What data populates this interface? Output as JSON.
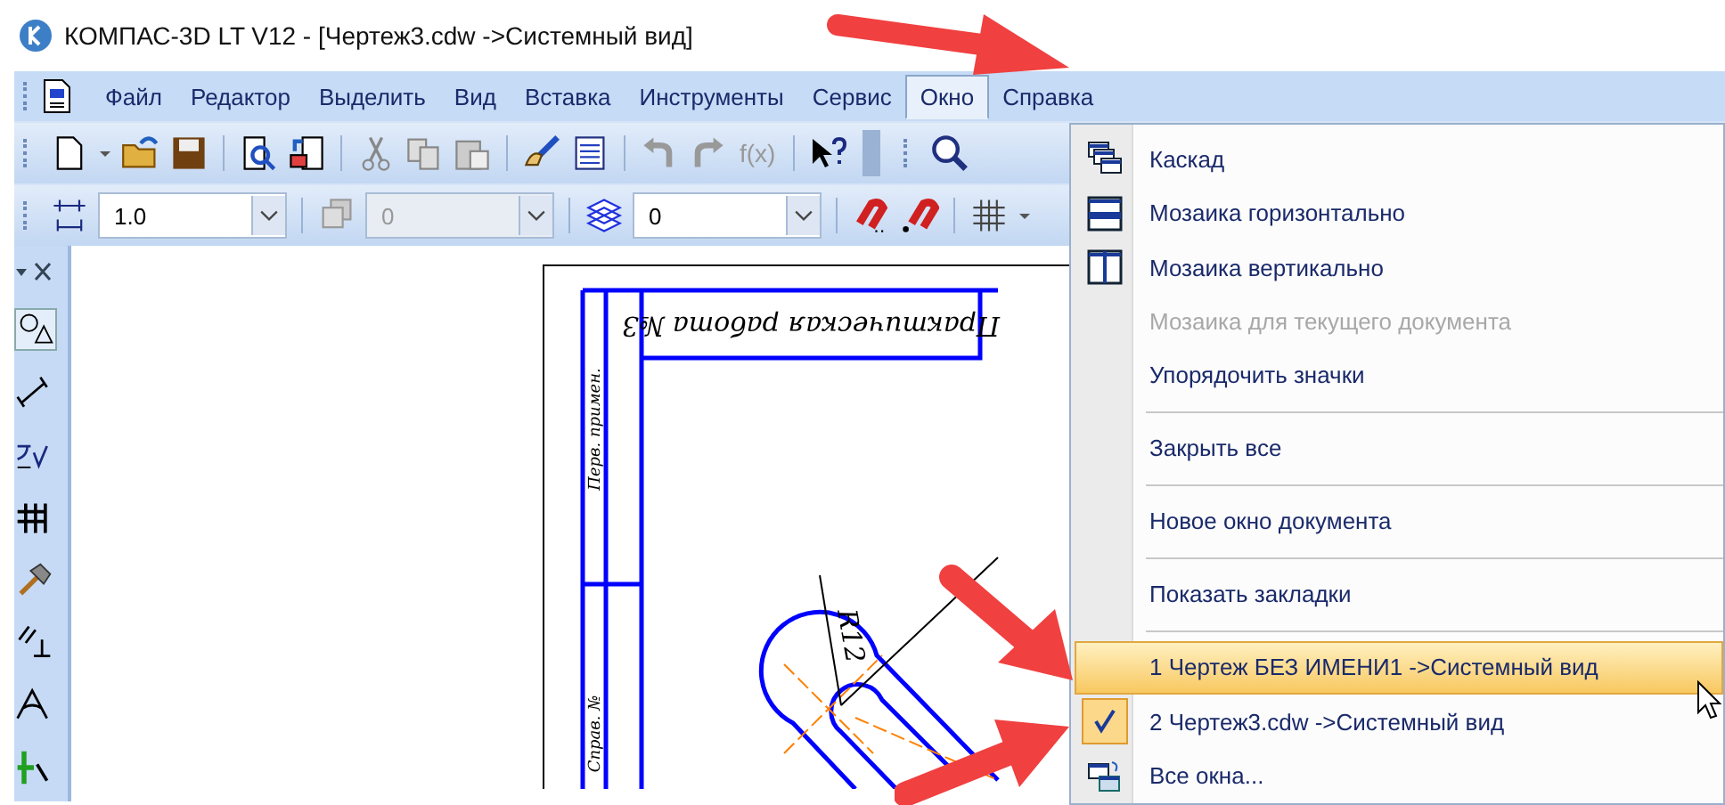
{
  "window": {
    "title": "КОМПАС-3D LT V12 - [Чертеж3.cdw ->Системный вид]"
  },
  "menu_bar": [
    {
      "label": "Файл",
      "selected": false
    },
    {
      "label": "Редактор",
      "selected": false
    },
    {
      "label": "Выделить",
      "selected": false
    },
    {
      "label": "Вид",
      "selected": false
    },
    {
      "label": "Вставка",
      "selected": false
    },
    {
      "label": "Инструменты",
      "selected": false
    },
    {
      "label": "Сервис",
      "selected": false
    },
    {
      "label": "Окно",
      "selected": true
    },
    {
      "label": "Справка",
      "selected": false
    }
  ],
  "toolbar": {
    "fx_label": "f(x)"
  },
  "properties_bar": {
    "combos": [
      {
        "value": "1.0",
        "disabled": false
      },
      {
        "value": "0",
        "disabled": true
      },
      {
        "value": "0",
        "disabled": false
      }
    ]
  },
  "drawing": {
    "title_block": "Практическая работа №3",
    "side_labels": [
      "Перв. примен.",
      "Справ. №"
    ],
    "dimension": "R12"
  },
  "window_menu": [
    {
      "kind": "item",
      "label": "Каскад",
      "disabled": false,
      "selected": false,
      "checked": false
    },
    {
      "kind": "item",
      "label": "Мозаика горизонтально",
      "disabled": false,
      "selected": false,
      "checked": false
    },
    {
      "kind": "item",
      "label": "Мозаика вертикально",
      "disabled": false,
      "selected": false,
      "checked": false
    },
    {
      "kind": "item",
      "label": "Мозаика для текущего документа",
      "disabled": true,
      "selected": false,
      "checked": false
    },
    {
      "kind": "item",
      "label": "Упорядочить значки",
      "disabled": false,
      "selected": false,
      "checked": false
    },
    {
      "kind": "separator"
    },
    {
      "kind": "item",
      "label": "Закрыть все",
      "disabled": false,
      "selected": false,
      "checked": false
    },
    {
      "kind": "separator"
    },
    {
      "kind": "item",
      "label": "Новое окно документа",
      "disabled": false,
      "selected": false,
      "checked": false
    },
    {
      "kind": "separator"
    },
    {
      "kind": "item",
      "label": "Показать закладки",
      "disabled": false,
      "selected": false,
      "checked": false
    },
    {
      "kind": "separator"
    },
    {
      "kind": "item",
      "label": "1 Чертеж БЕЗ ИМЕНИ1 ->Системный вид",
      "disabled": false,
      "selected": true,
      "checked": false
    },
    {
      "kind": "item",
      "label": "2 Чертеж3.cdw ->Системный вид",
      "disabled": false,
      "selected": false,
      "checked": true
    },
    {
      "kind": "item",
      "label": "Все окна...",
      "disabled": false,
      "selected": false,
      "checked": false
    }
  ]
}
